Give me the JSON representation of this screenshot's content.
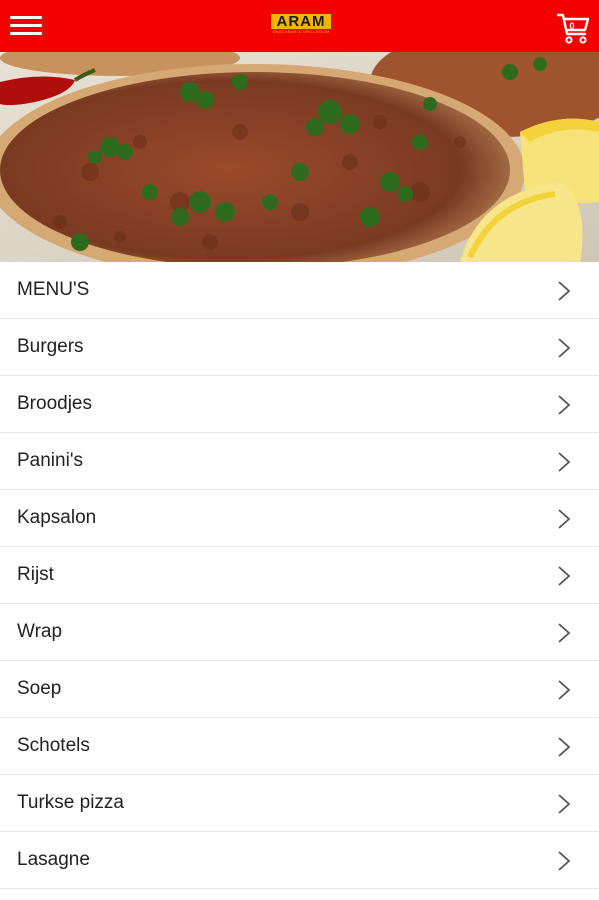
{
  "header": {
    "logo_text": "ARAM",
    "logo_subtext": "SNACKBAR & GRILLROOM",
    "cart_count": "0",
    "brand_color": "#f40000",
    "logo_color": "#f5b400",
    "icons": {
      "menu": "hamburger-menu-icon",
      "cart": "shopping-cart-icon"
    }
  },
  "hero": {
    "icon": "food-banner-image"
  },
  "menu": {
    "items": [
      {
        "label": "MENU'S"
      },
      {
        "label": "Burgers"
      },
      {
        "label": "Broodjes"
      },
      {
        "label": "Panini's"
      },
      {
        "label": "Kapsalon"
      },
      {
        "label": "Rijst"
      },
      {
        "label": "Wrap"
      },
      {
        "label": "Soep"
      },
      {
        "label": "Schotels"
      },
      {
        "label": "Turkse pizza"
      },
      {
        "label": "Lasagne"
      }
    ],
    "chevron_icon": "chevron-right-icon"
  }
}
